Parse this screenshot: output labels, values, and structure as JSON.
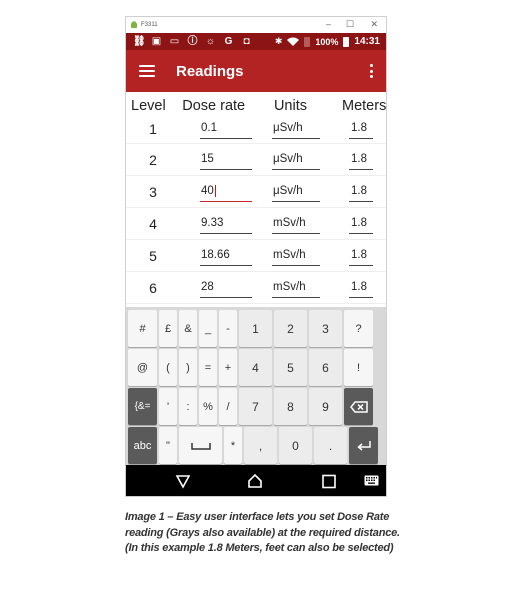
{
  "window": {
    "title": "F3311",
    "minimize": "–",
    "maximize": "☐",
    "close": "✕"
  },
  "statusbar": {
    "left_icons": [
      "link-icon",
      "sim-icon",
      "message-icon",
      "info-icon",
      "bulb-icon",
      "google-icon",
      "android-icon"
    ],
    "battery_percent": "100%",
    "time": "14:31"
  },
  "appbar": {
    "title": "Readings"
  },
  "table": {
    "headers": [
      "Level",
      "Dose rate",
      "Units",
      "Meters"
    ],
    "rows": [
      {
        "level": "1",
        "dose": "0.1",
        "units": "μSv/h",
        "meters": "1.8",
        "active": false
      },
      {
        "level": "2",
        "dose": "15",
        "units": "μSv/h",
        "meters": "1.8",
        "active": false
      },
      {
        "level": "3",
        "dose": "40",
        "units": "μSv/h",
        "meters": "1.8",
        "active": true
      },
      {
        "level": "4",
        "dose": "9.33",
        "units": "mSv/h",
        "meters": "1.8",
        "active": false
      },
      {
        "level": "5",
        "dose": "18.66",
        "units": "mSv/h",
        "meters": "1.8",
        "active": false
      },
      {
        "level": "6",
        "dose": "28",
        "units": "mSv/h",
        "meters": "1.8",
        "active": false
      }
    ]
  },
  "keyboard": {
    "rows": [
      [
        "#",
        "£",
        "&",
        "_",
        "-",
        "1",
        "2",
        "3",
        "?"
      ],
      [
        "@",
        "(",
        ")",
        "=",
        "+",
        "4",
        "5",
        "6",
        "!"
      ],
      [
        "{&=",
        "'",
        ":",
        "%",
        "/",
        "7",
        "8",
        "9",
        "⌫"
      ],
      [
        "abc",
        "\"",
        "␣",
        "*",
        ",",
        "0",
        ".",
        "↵"
      ]
    ]
  },
  "navbar": {
    "buttons": [
      "back",
      "home",
      "recents",
      "keyboard-switch"
    ]
  },
  "caption": "Image 1 – Easy user interface lets you set Dose Rate reading (Grays also available) at the required distance. (In this example 1.8 Meters, feet can also be selected)"
}
